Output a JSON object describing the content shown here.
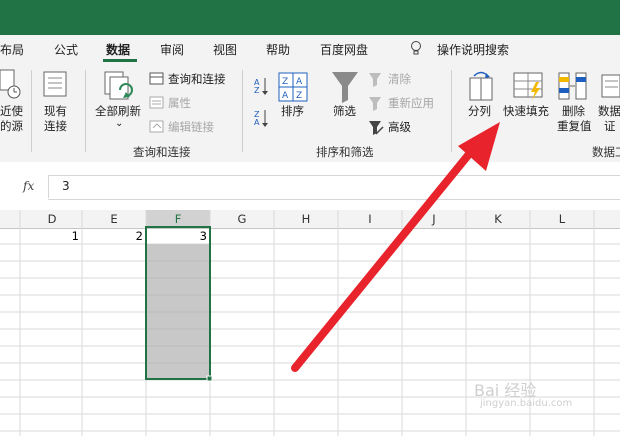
{
  "menu": {
    "items": [
      "布局",
      "公式",
      "数据",
      "审阅",
      "视图",
      "帮助",
      "百度网盘"
    ],
    "active": "数据",
    "tell_me": "操作说明搜索"
  },
  "ribbon": {
    "recent_sources": [
      "近使",
      "的源"
    ],
    "existing_connections": [
      "现有",
      "连接"
    ],
    "refresh_all": "全部刷新",
    "queries_connections": "查询和连接",
    "properties": "属性",
    "edit_links": "编辑链接",
    "group_queries": "查询和连接",
    "sort": "排序",
    "filter": "筛选",
    "clear": "清除",
    "reapply": "重新应用",
    "advanced": "高级",
    "group_sort_filter": "排序和筛选",
    "text_to_columns": "分列",
    "flash_fill": "快速填充",
    "remove_duplicates": [
      "删除",
      "重复值"
    ],
    "data_validation": [
      "数据",
      "证"
    ],
    "group_data_tools": "数据工"
  },
  "formula_bar": {
    "fx": "fx",
    "value": "3"
  },
  "columns": [
    "D",
    "E",
    "F",
    "G",
    "H",
    "I",
    "J",
    "K",
    "L"
  ],
  "selected_column": "F",
  "cells": {
    "D1": "1",
    "E1": "2",
    "F1": "3"
  },
  "watermark": {
    "main": "Bai 经验",
    "sub": "jingyan.baidu.com"
  },
  "colors": {
    "excel_green": "#217346",
    "arrow_red": "#e8232c",
    "selection_fill": "#c8c8c8"
  }
}
